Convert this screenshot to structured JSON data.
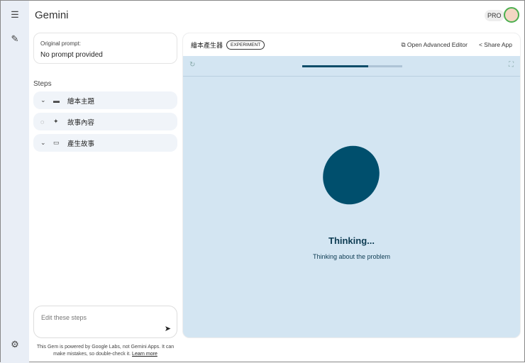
{
  "app": {
    "title": "Gemini",
    "plan_badge": "PRO"
  },
  "prompt": {
    "label": "Original prompt:",
    "value": "No prompt provided"
  },
  "steps": {
    "heading": "Steps",
    "items": [
      {
        "label": "繪本主題",
        "status": "collapsed"
      },
      {
        "label": "故事內容",
        "status": "loading"
      },
      {
        "label": "產生故事",
        "status": "collapsed"
      }
    ]
  },
  "editor": {
    "placeholder": "Edit these steps"
  },
  "footer": {
    "text": "This Gem is powered by Google Labs, not Gemini Apps. It can make mistakes, so double-check it.",
    "link": "Learn more"
  },
  "app_panel": {
    "name": "繪本產生器",
    "badge": "EXPERIMENT",
    "open_editor": "Open Advanced Editor",
    "share": "Share App",
    "progress": 0.66,
    "status_title": "Thinking...",
    "status_text": "Thinking about the problem"
  }
}
